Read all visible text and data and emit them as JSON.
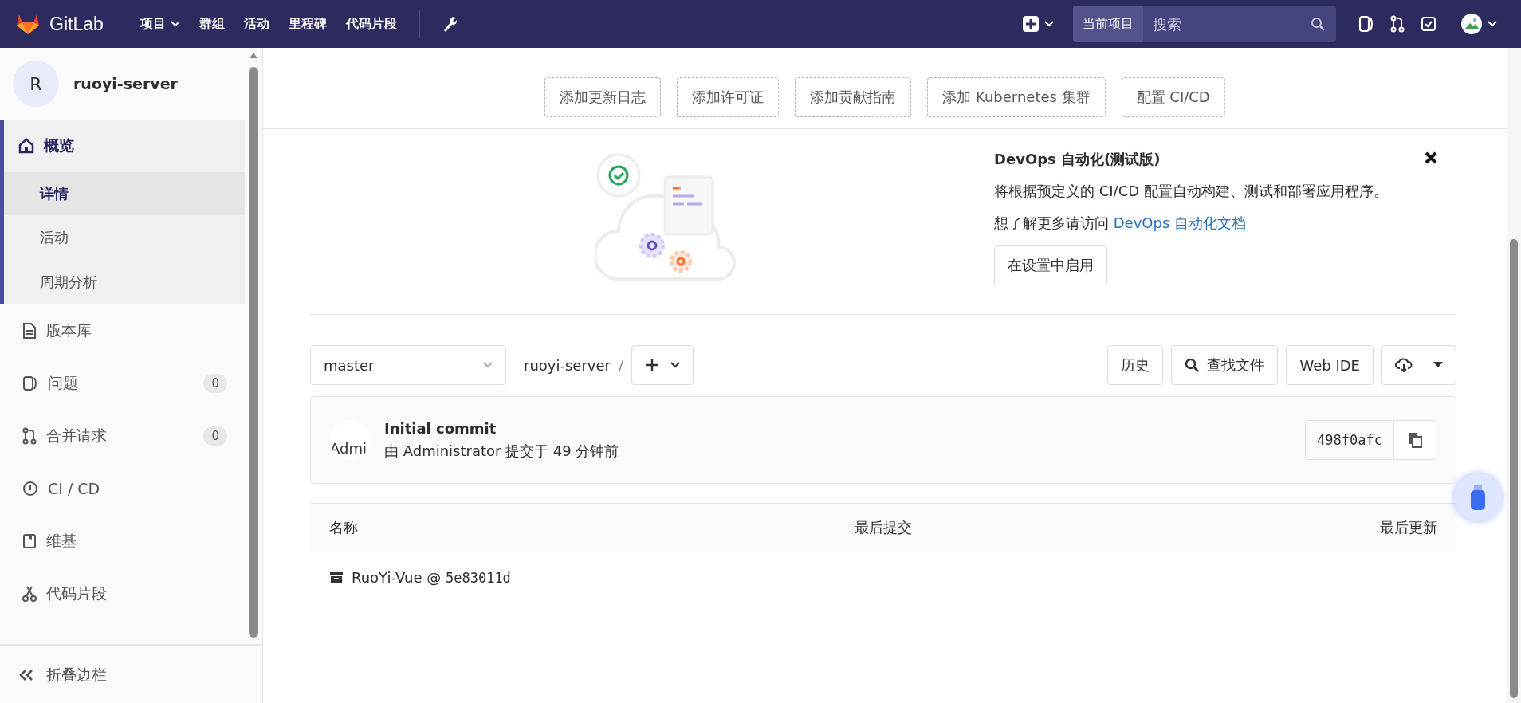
{
  "navbar": {
    "brand": "GitLab",
    "menu": [
      {
        "label": "项目",
        "dropdown": true
      },
      {
        "label": "群组",
        "dropdown": false
      },
      {
        "label": "活动",
        "dropdown": false
      },
      {
        "label": "里程碑",
        "dropdown": false
      },
      {
        "label": "代码片段",
        "dropdown": false
      }
    ],
    "search": {
      "scope": "当前项目",
      "placeholder": "搜索"
    }
  },
  "sidebar": {
    "project": {
      "initial": "R",
      "name": "ruoyi-server"
    },
    "items": [
      {
        "kind": "home",
        "label": "概览",
        "expanded": true,
        "selected": true,
        "children": [
          {
            "label": "详情",
            "selected": true
          },
          {
            "label": "活动",
            "selected": false
          },
          {
            "label": "周期分析",
            "selected": false
          }
        ]
      },
      {
        "kind": "doc",
        "label": "版本库",
        "selected": false
      },
      {
        "kind": "issues",
        "label": "问题",
        "count": "0",
        "selected": false
      },
      {
        "kind": "merge",
        "label": "合并请求",
        "count": "0",
        "selected": false
      },
      {
        "kind": "cicd",
        "label": "CI / CD",
        "selected": false
      },
      {
        "kind": "wiki",
        "label": "维基",
        "selected": false
      },
      {
        "kind": "snippet",
        "label": "代码片段",
        "selected": false
      }
    ],
    "collapse": "折叠边栏"
  },
  "suggestions": [
    "添加更新日志",
    "添加许可证",
    "添加贡献指南",
    "添加 Kubernetes 集群",
    "配置 CI/CD"
  ],
  "devops_banner": {
    "title": "DevOps 自动化(测试版)",
    "description": "将根据预定义的 CI/CD 配置自动构建、测试和部署应用程序。",
    "learn_more": "想了解更多请访问",
    "link": "DevOps 自动化文档",
    "button": "在设置中启用"
  },
  "tree_controls": {
    "branch": "master",
    "path": "ruoyi-server",
    "separator": "/",
    "buttons": [
      "历史",
      "查找文件",
      "Web IDE"
    ]
  },
  "last_commit": {
    "avatar_alt": "Admi",
    "title": "Initial commit",
    "meta": "由 Administrator 提交于 49 分钟前",
    "sha": "498f0afc"
  },
  "table": {
    "columns": [
      "名称",
      "最后提交",
      "最后更新"
    ],
    "rows": [
      {
        "kind": "submodule",
        "name": "RuoYi-Vue",
        "separator": "@",
        "commit": "5e83011d"
      }
    ]
  }
}
